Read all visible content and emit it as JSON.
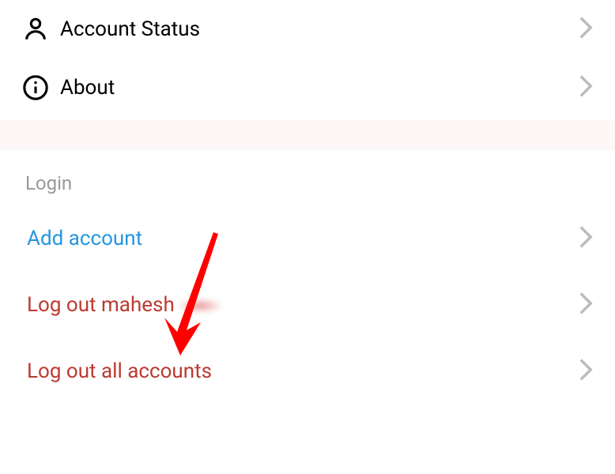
{
  "settingsItems": [
    {
      "label": "Account Status",
      "icon": "person"
    },
    {
      "label": "About",
      "icon": "info"
    }
  ],
  "loginSection": {
    "header": "Login",
    "items": [
      {
        "label": "Add account",
        "color": "blue"
      },
      {
        "label": "Log out mahesh",
        "color": "red",
        "blurred": true
      },
      {
        "label": "Log out all accounts",
        "color": "red"
      }
    ]
  }
}
